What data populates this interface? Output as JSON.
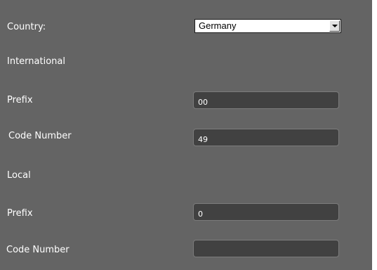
{
  "form": {
    "country_label": "Country:",
    "country_value": "Germany",
    "international_heading": "International",
    "intl_prefix_label": "Prefix",
    "intl_prefix_value": "00",
    "intl_code_label": "Code  Number",
    "intl_code_value": "49",
    "local_heading": "Local",
    "local_prefix_label": "Prefix",
    "local_prefix_value": "0",
    "local_code_label": "Code  Number",
    "local_code_value": ""
  },
  "icons": {
    "dropdown": "chevron-down-icon"
  },
  "colors": {
    "panel_background": "#646464",
    "field_background": "#414141",
    "label_text": "#ffffff"
  }
}
